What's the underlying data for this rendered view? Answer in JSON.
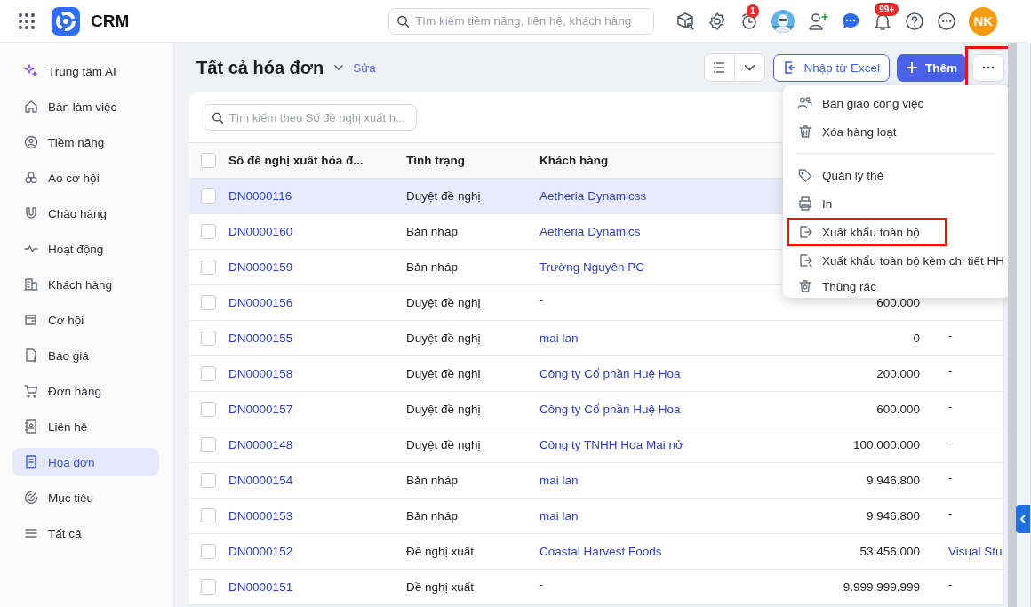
{
  "app": {
    "name": "CRM"
  },
  "search": {
    "placeholder": "Tìm kiếm tiềm năng, liên hệ, khách hàng"
  },
  "notifications": {
    "timer_badge": "1",
    "bell_badge": "99+"
  },
  "user": {
    "initials": "NK"
  },
  "sidebar": {
    "items": [
      {
        "label": "Trung tâm AI",
        "selected": false
      },
      {
        "label": "Bàn làm việc",
        "selected": false
      },
      {
        "label": "Tiềm năng",
        "selected": false
      },
      {
        "label": "Ao cơ hội",
        "selected": false
      },
      {
        "label": "Chào hàng",
        "selected": false
      },
      {
        "label": "Hoạt động",
        "selected": false
      },
      {
        "label": "Khách hàng",
        "selected": false
      },
      {
        "label": "Cơ hội",
        "selected": false
      },
      {
        "label": "Báo giá",
        "selected": false
      },
      {
        "label": "Đơn hàng",
        "selected": false
      },
      {
        "label": "Liên hệ",
        "selected": false
      },
      {
        "label": "Hóa đơn",
        "selected": true
      },
      {
        "label": "Mục tiêu",
        "selected": false
      },
      {
        "label": "Tất cả",
        "selected": false
      }
    ]
  },
  "page": {
    "title": "Tất cả hóa đơn",
    "edit_link": "Sửa",
    "import_button": "Nhập từ Excel",
    "add_button": "Thêm",
    "more_button": {
      "highlighted": true
    }
  },
  "table": {
    "select_all": {
      "checked": false
    },
    "search_placeholder": "Tìm kiếm theo Số đề nghị xuất h...",
    "columns": [
      "Số đề nghị xuất hóa đ...",
      "Tình trạng",
      "Khách hàng"
    ],
    "rows": [
      {
        "selected": true,
        "checked": false,
        "number": "DN0000116",
        "status": "Duyệt đề nghị",
        "customer": "Aetheria Dynamicss",
        "customer_linked": true
      },
      {
        "selected": false,
        "checked": false,
        "number": "DN0000160",
        "status": "Bản nháp",
        "customer": "Aetheria Dynamics",
        "customer_linked": true
      },
      {
        "selected": false,
        "checked": false,
        "number": "DN0000159",
        "status": "Bản nháp",
        "customer": "Trường Nguyên PC",
        "customer_linked": true
      },
      {
        "selected": false,
        "checked": false,
        "number": "DN0000156",
        "status": "Duyệt đề nghị",
        "customer": "-",
        "customer_linked": false,
        "amount": "600.000"
      },
      {
        "selected": false,
        "checked": false,
        "number": "DN0000155",
        "status": "Duyệt đề nghị",
        "customer": "mai lan",
        "customer_linked": true,
        "amount": "0",
        "column_5": "-",
        "column_5_linked": false
      },
      {
        "selected": false,
        "checked": false,
        "number": "DN0000158",
        "status": "Duyệt đề nghị",
        "customer": "Công ty Cổ phần Huệ Hoa",
        "customer_linked": true,
        "amount": "200.000",
        "column_5": "-",
        "column_5_linked": false
      },
      {
        "selected": false,
        "checked": false,
        "number": "DN0000157",
        "status": "Duyệt đề nghị",
        "customer": "Công ty Cổ phần Huệ Hoa",
        "customer_linked": true,
        "amount": "600.000",
        "column_5": "-",
        "column_5_linked": false
      },
      {
        "selected": false,
        "checked": false,
        "number": "DN0000148",
        "status": "Duyệt đề nghị",
        "customer": "Công ty TNHH Hoa Mai nở",
        "customer_linked": true,
        "amount": "100.000.000",
        "column_5": "-",
        "column_5_linked": false
      },
      {
        "selected": false,
        "checked": false,
        "number": "DN0000154",
        "status": "Bản nháp",
        "customer": "mai lan",
        "customer_linked": true,
        "amount": "9.946.800",
        "column_5": "-",
        "column_5_linked": false
      },
      {
        "selected": false,
        "checked": false,
        "number": "DN0000153",
        "status": "Bản nháp",
        "customer": "mai lan",
        "customer_linked": true,
        "amount": "9.946.800",
        "column_5": "-",
        "column_5_linked": false
      },
      {
        "selected": false,
        "checked": false,
        "number": "DN0000152",
        "status": "Đề nghị xuất",
        "customer": "Coastal Harvest Foods",
        "customer_linked": true,
        "amount": "53.456.000",
        "column_5": "Visual Stu",
        "column_5_linked": true
      },
      {
        "selected": false,
        "checked": false,
        "number": "DN0000151",
        "status": "Đề nghị xuất",
        "customer": "-",
        "customer_linked": false,
        "amount": "9.999.999.999",
        "column_5": "-",
        "column_5_linked": false
      }
    ]
  },
  "menu": {
    "sections": [
      [
        {
          "label": "Bàn giao công việc",
          "highlighted": false
        },
        {
          "label": "Xóa hàng loạt",
          "highlighted": false
        }
      ],
      [
        {
          "label": "Quản lý thẻ",
          "highlighted": false
        },
        {
          "label": "In",
          "highlighted": false
        },
        {
          "label": "Xuất khẩu toàn bộ",
          "highlighted": true
        },
        {
          "label": "Xuất khẩu toàn bộ kèm chi tiết HH",
          "highlighted": false
        },
        {
          "label": "Thùng rác",
          "highlighted": false
        }
      ]
    ]
  }
}
